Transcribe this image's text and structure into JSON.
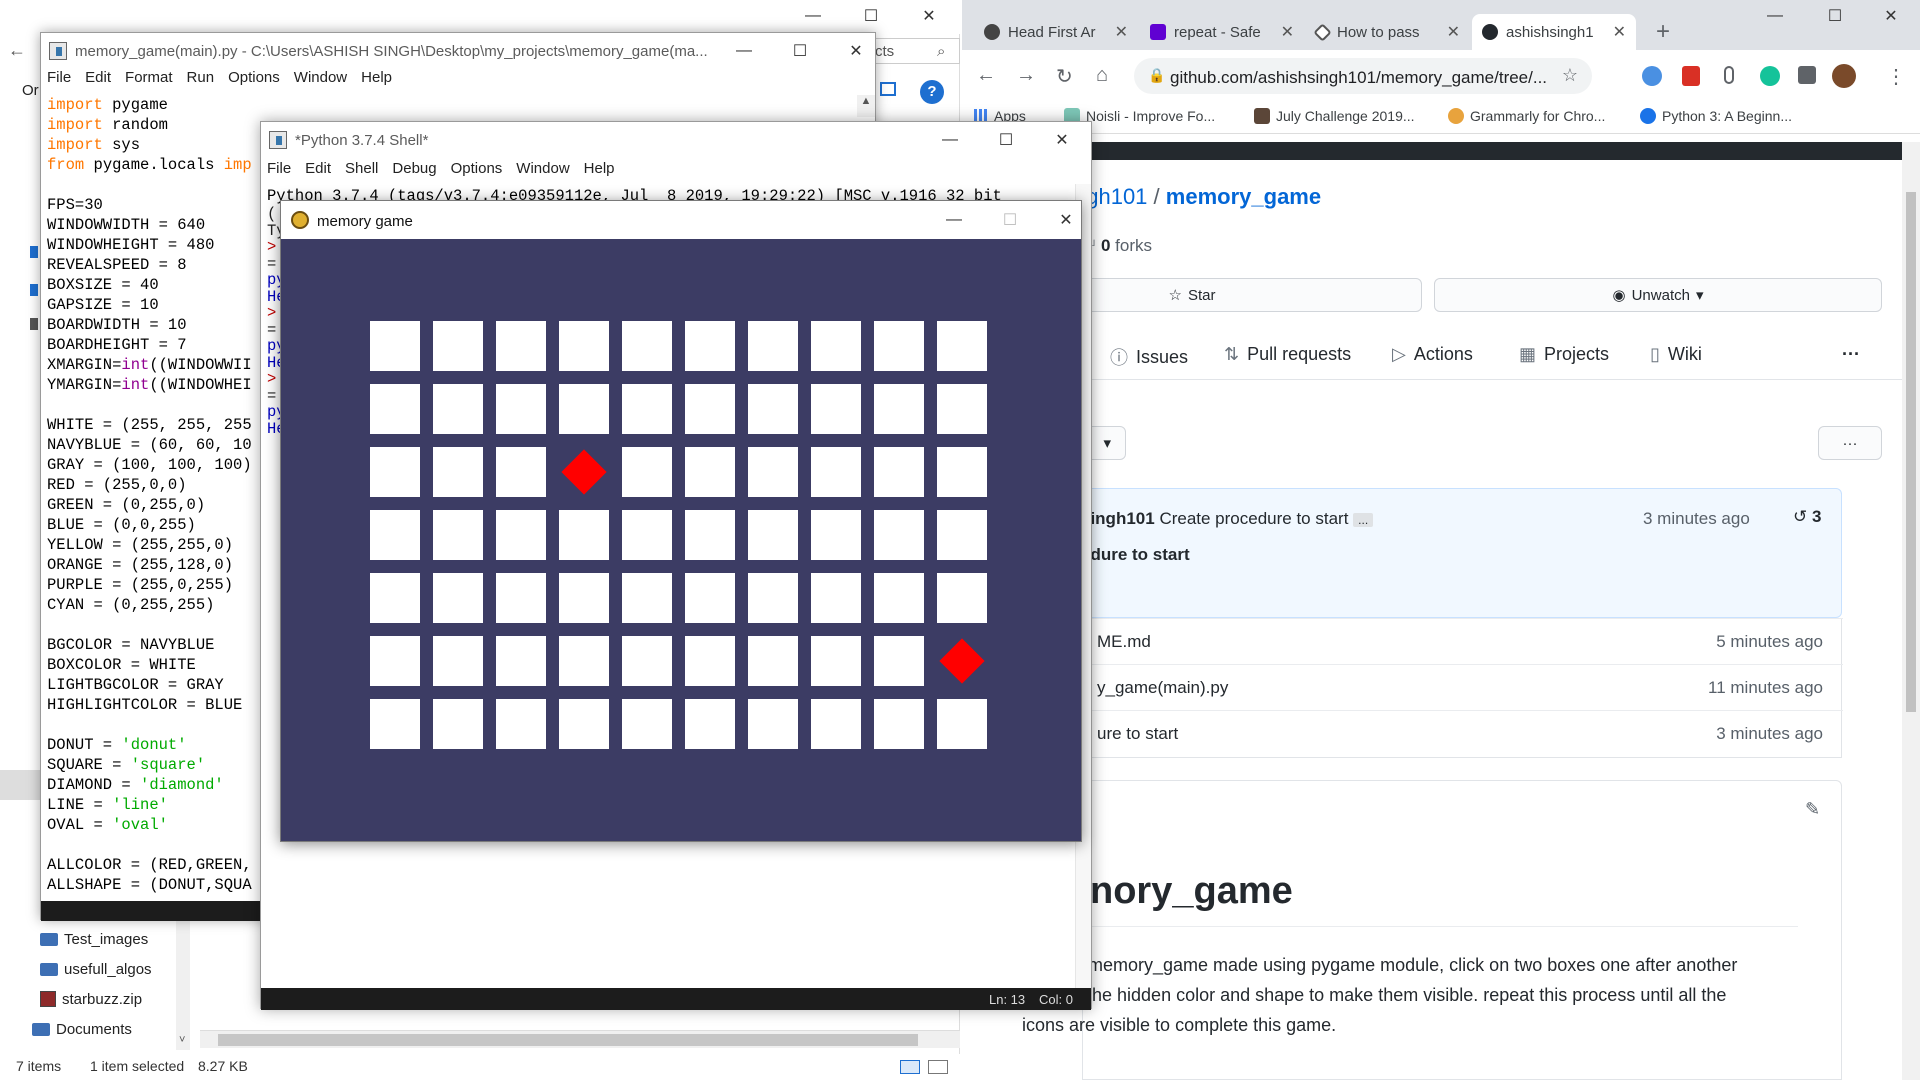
{
  "explorer": {
    "nav_back": "←",
    "left_label": "Or",
    "search_suffix": "cts",
    "search_icon": "⌕",
    "tree": [
      {
        "label": "Test_images",
        "icon": "folder"
      },
      {
        "label": "usefull_algos",
        "icon": "folder"
      },
      {
        "label": "starbuzz.zip",
        "icon": "zip"
      },
      {
        "label": "Documents",
        "icon": "folder"
      }
    ],
    "status": {
      "items": "7 items",
      "selected": "1 item selected",
      "size": "8.27 KB"
    }
  },
  "chrome": {
    "tabs": [
      {
        "title": "Head First Ar",
        "icon_color": "#444444"
      },
      {
        "title": "repeat - Safe",
        "icon_color": "#6001d2"
      },
      {
        "title": "How to pass",
        "icon_color": "#555555"
      },
      {
        "title": "ashishsingh1",
        "icon_color": "#24292e"
      }
    ],
    "new_tab": "+",
    "url": "github.com/ashishsingh101/memory_game/tree/...",
    "bookmarks": [
      "Apps",
      "Noisli - Improve Fo...",
      "July Challenge 2019...",
      "Grammarly for Chro...",
      "Python 3: A Beginn..."
    ]
  },
  "github": {
    "owner_partial": "ngh101",
    "separator": "/",
    "repo": "memory_game",
    "forks_count": "0",
    "forks_label": "forks",
    "star_label": "Star",
    "unwatch_label": "Unwatch",
    "tabs": [
      "Issues",
      "Pull requests",
      "Actions",
      "Projects",
      "Wiki"
    ],
    "more": "···",
    "commit": {
      "author": "singh101",
      "message": "Create procedure to start",
      "ellipsis": "...",
      "time": "3 minutes ago",
      "count": "3",
      "title_partial": "edure to start"
    },
    "files": [
      {
        "name": "ME.md",
        "time": "5 minutes ago"
      },
      {
        "name": "y_game(main).py",
        "time": "11 minutes ago"
      },
      {
        "name": "ure to start",
        "time": "3 minutes ago"
      }
    ],
    "readme_header_partial": "d",
    "readme_title": "nory_game",
    "readme_lines": [
      "memory_game made using pygame module, click on two boxes one after another",
      "he hidden color and shape to make them visible. repeat this process until all the",
      "icons are visible to complete this game."
    ]
  },
  "editor": {
    "title": "memory_game(main).py - C:\\Users\\ASHISH SINGH\\Desktop\\my_projects\\memory_game(ma...",
    "menu": [
      "File",
      "Edit",
      "Format",
      "Run",
      "Options",
      "Window",
      "Help"
    ],
    "code": [
      "import pygame",
      "import random",
      "import sys",
      "from pygame.locals imp",
      "",
      "FPS=30",
      "WINDOWWIDTH = 640",
      "WINDOWHEIGHT = 480",
      "REVEALSPEED = 8",
      "BOXSIZE = 40",
      "GAPSIZE = 10",
      "BOARDWIDTH = 10",
      "BOARDHEIGHT = 7",
      "XMARGIN=int((WINDOWWII",
      "YMARGIN=int((WINDOWHEI",
      "",
      "WHITE = (255, 255, 255",
      "NAVYBLUE = (60, 60, 10",
      "GRAY = (100, 100, 100)",
      "RED = (255,0,0)",
      "GREEN = (0,255,0)",
      "BLUE = (0,0,255)",
      "YELLOW = (255,255,0)",
      "ORANGE = (255,128,0)",
      "PURPLE = (255,0,255)",
      "CYAN = (0,255,255)",
      "",
      "BGCOLOR = NAVYBLUE",
      "BOXCOLOR = WHITE",
      "LIGHTBGCOLOR = GRAY",
      "HIGHLIGHTCOLOR = BLUE",
      "",
      "DONUT = 'donut'",
      "SQUARE = 'square'",
      "DIAMOND = 'diamond'",
      "LINE = 'line'",
      "OVAL = 'oval'",
      "",
      "ALLCOLOR = (RED,GREEN,",
      "ALLSHAPE = (DONUT,SQUA"
    ]
  },
  "shell": {
    "title": "*Python 3.7.4 Shell*",
    "menu": [
      "File",
      "Edit",
      "Shell",
      "Debug",
      "Options",
      "Window",
      "Help"
    ],
    "banner": "Python 3.7.4 (tags/v3.7.4:e09359112e, Jul  8 2019, 19:29:22) [MSC v.1916 32 bit",
    "left_fragments": [
      "(",
      "Ty",
      ">",
      "=",
      "py",
      "He",
      ">",
      "=",
      "py",
      "He",
      ">",
      "=",
      "py",
      "He"
    ],
    "status": {
      "line": "Ln: 13",
      "col": "Col: 0"
    }
  },
  "pygame": {
    "title": "memory game",
    "board": {
      "cols": 10,
      "rows": 7,
      "bg_color": "#3c3c64",
      "box_color": "#ffffff"
    },
    "revealed": [
      {
        "col": 3,
        "row": 2,
        "shape": "diamond",
        "color": "#ff0000"
      },
      {
        "col": 9,
        "row": 5,
        "shape": "diamond",
        "color": "#ff0000"
      }
    ]
  },
  "window_controls": {
    "minimize": "—",
    "maximize": "☐",
    "close": "✕"
  }
}
